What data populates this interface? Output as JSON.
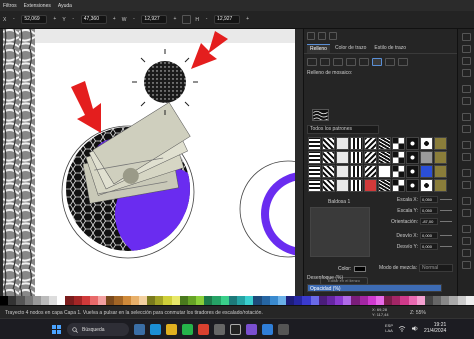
{
  "menubar": {
    "items": [
      "Filtros",
      "Extensiones",
      "Ayuda"
    ]
  },
  "controls": {
    "x_label": "X",
    "x_value": "52,069",
    "y_label": "Y",
    "y_value": "47,360",
    "w_label": "W",
    "w_value": "12,927",
    "h_label": "H",
    "h_value": "12,927",
    "unit_minus": "-",
    "unit_plus": "+"
  },
  "dock": {
    "tabs": [
      "Relleno",
      "Color de trazo",
      "Estilo de trazo"
    ],
    "section_title": "Relleno de mosaico:",
    "pattern_select": "Todos los patrones",
    "preview_name": "Baldosa 1",
    "color_label": "Color:",
    "edit_button": "Editar en el lienzo",
    "params": [
      {
        "label": "Escala X:",
        "value": "0,050"
      },
      {
        "label": "Escala Y:",
        "value": "0,050"
      },
      {
        "label": "Orientación:",
        "value": "-87,00"
      },
      {
        "label": "Desvío X:",
        "value": "0,000"
      },
      {
        "label": "Desvío Y:",
        "value": "0,000"
      },
      {
        "label": "Hueco X:",
        "value": "0%"
      },
      {
        "label": "Hueco Y:",
        "value": "0%"
      }
    ],
    "blend_label": "Modo de mezcla:",
    "blend_value": "Normal",
    "blur_label": "Desenfoque (%)",
    "opacity_label": "Opacidad (%)",
    "opacity_value": 100
  },
  "status": {
    "message": "Trayecto 4 nodos en capa Capa 1. Vuelva a pulsar en la selección para conmutar los tiradores de escalado/rotación.",
    "x_label": "X:",
    "x_value": "69,28",
    "y_label": "Y:",
    "y_value": "117,44",
    "zoom": "Z: 55%"
  },
  "taskbar": {
    "search_label": "Búsqueda",
    "lang_top": "ESP",
    "lang_bottom": "LAA",
    "time": "19:21",
    "date": "21/4/2024"
  },
  "colors": {
    "accent_purple": "#6a2cf0",
    "arrow_red": "#e41e1e",
    "selection_blue": "#3d6bb3"
  },
  "icons": [
    "search-icon",
    "windows-start-icon",
    "edge-icon",
    "chrome-icon",
    "whatsapp-icon",
    "explorer-icon",
    "inkscape-icon",
    "wifi-icon",
    "volume-icon"
  ]
}
